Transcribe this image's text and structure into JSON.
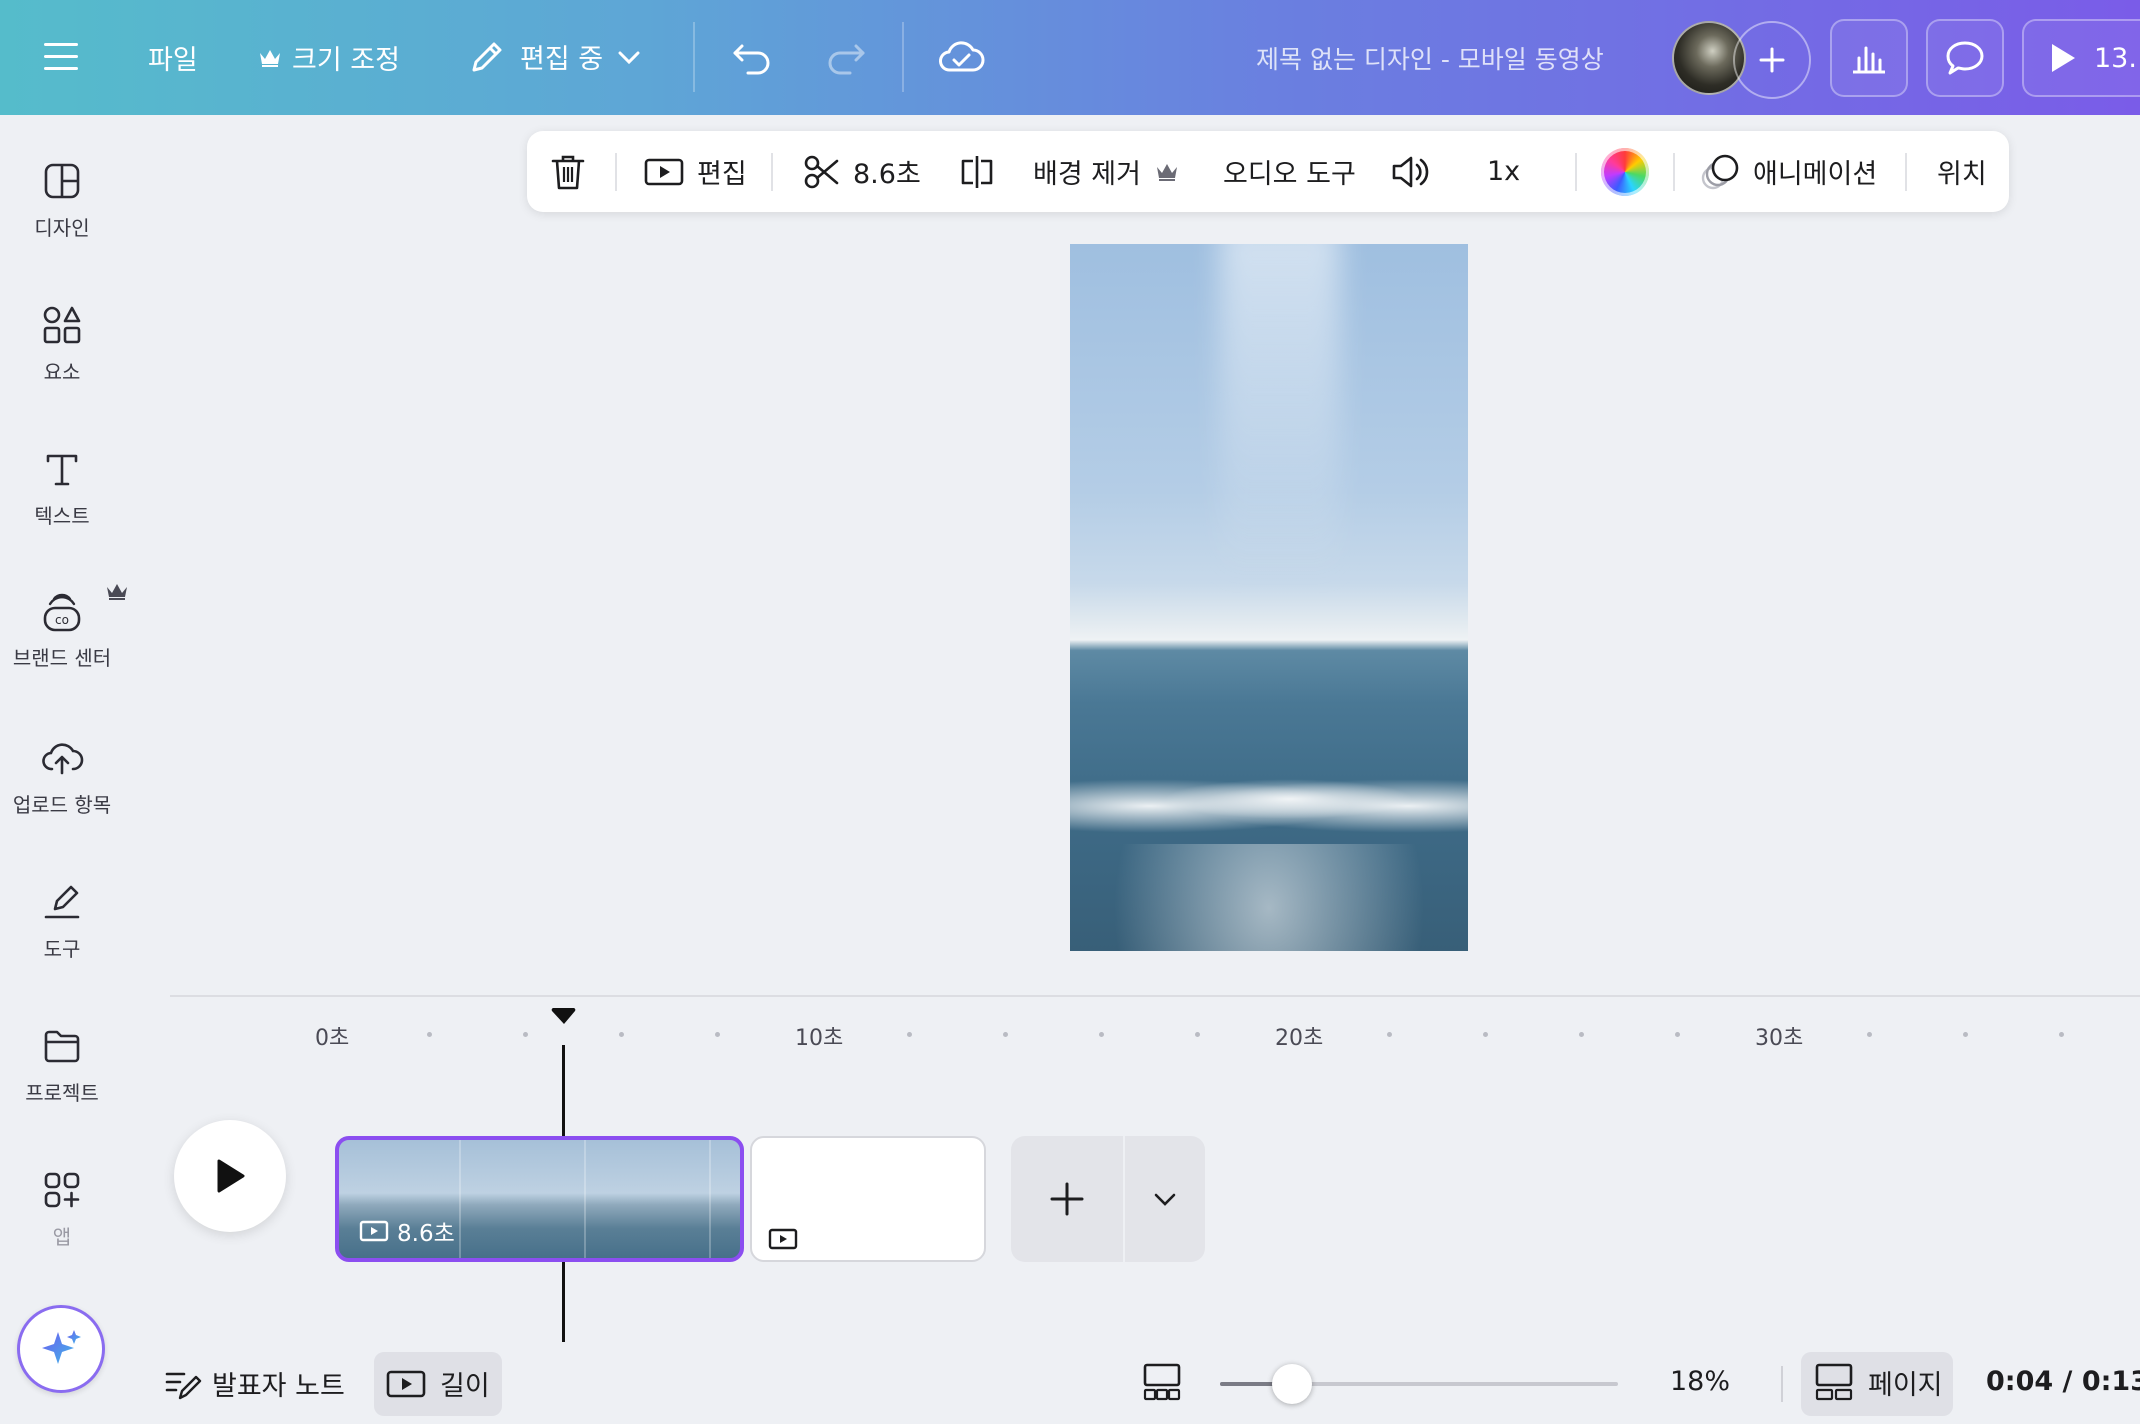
{
  "header": {
    "file_label": "파일",
    "resize_label": "크기 조정",
    "editing_label": "편집 중",
    "title": "제목 없는 디자인 - 모바일 동영상",
    "present_label": "13."
  },
  "sidebar": {
    "items": [
      {
        "label": "디자인",
        "icon": "layout-icon"
      },
      {
        "label": "요소",
        "icon": "shapes-icon"
      },
      {
        "label": "텍스트",
        "icon": "text-icon"
      },
      {
        "label": "브랜드 센터",
        "icon": "brand-icon"
      },
      {
        "label": "업로드 항목",
        "icon": "cloud-upload-icon"
      },
      {
        "label": "도구",
        "icon": "pen-tool-icon"
      },
      {
        "label": "프로젝트",
        "icon": "folder-icon"
      },
      {
        "label": "앱",
        "icon": "apps-icon"
      }
    ]
  },
  "toolbar": {
    "edit_label": "편집",
    "trim_label": "8.6초",
    "bg_remove_label": "배경 제거",
    "audio_tools_label": "오디오 도구",
    "speed_label": "1x",
    "animation_label": "애니메이션",
    "position_label": "위치"
  },
  "timeline": {
    "ticks": [
      {
        "label": "0초"
      },
      {
        "label": "10초"
      },
      {
        "label": "20초"
      },
      {
        "label": "30초"
      }
    ],
    "clip1_duration": "8.6초",
    "playhead_seconds": 4.8
  },
  "bottom": {
    "notes_label": "발표자 노트",
    "duration_label": "길이",
    "zoom_label": "18%",
    "zoom_level": 0.18,
    "pages_label": "페이지",
    "time_label": "0:04 / 0:13"
  },
  "colors": {
    "header_start": "#55bccb",
    "header_end": "#7a5ce8",
    "clip_selected_border": "#8b4ef0"
  }
}
